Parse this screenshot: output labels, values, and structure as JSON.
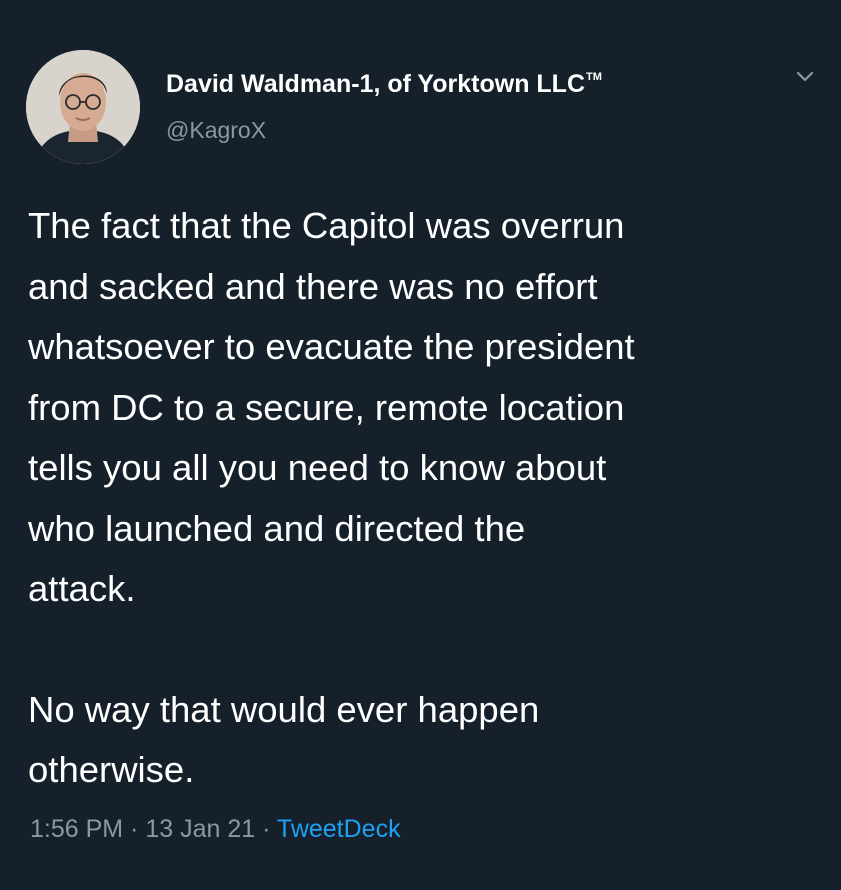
{
  "author": {
    "display_name": "David Waldman-1, of Yorktown LLC",
    "trademark": "TM",
    "handle": "@KagroX"
  },
  "tweet": {
    "lines": [
      "The fact that the Capitol was overrun",
      "and sacked and there was no effort",
      "whatsoever to evacuate the president",
      "from DC to a secure, remote location",
      "tells you all you need to know about",
      "who launched and directed the",
      "attack.",
      "No way that would ever happen",
      "otherwise."
    ]
  },
  "meta": {
    "time": "1:56 PM",
    "separator": " · ",
    "date": "13 Jan 21",
    "source": "TweetDeck"
  },
  "icons": {
    "menu": "chevron-down-icon",
    "avatar": "avatar"
  },
  "colors": {
    "background": "#15202b",
    "text": "#ffffff",
    "secondary": "#8899a6",
    "link": "#1da1f2"
  }
}
